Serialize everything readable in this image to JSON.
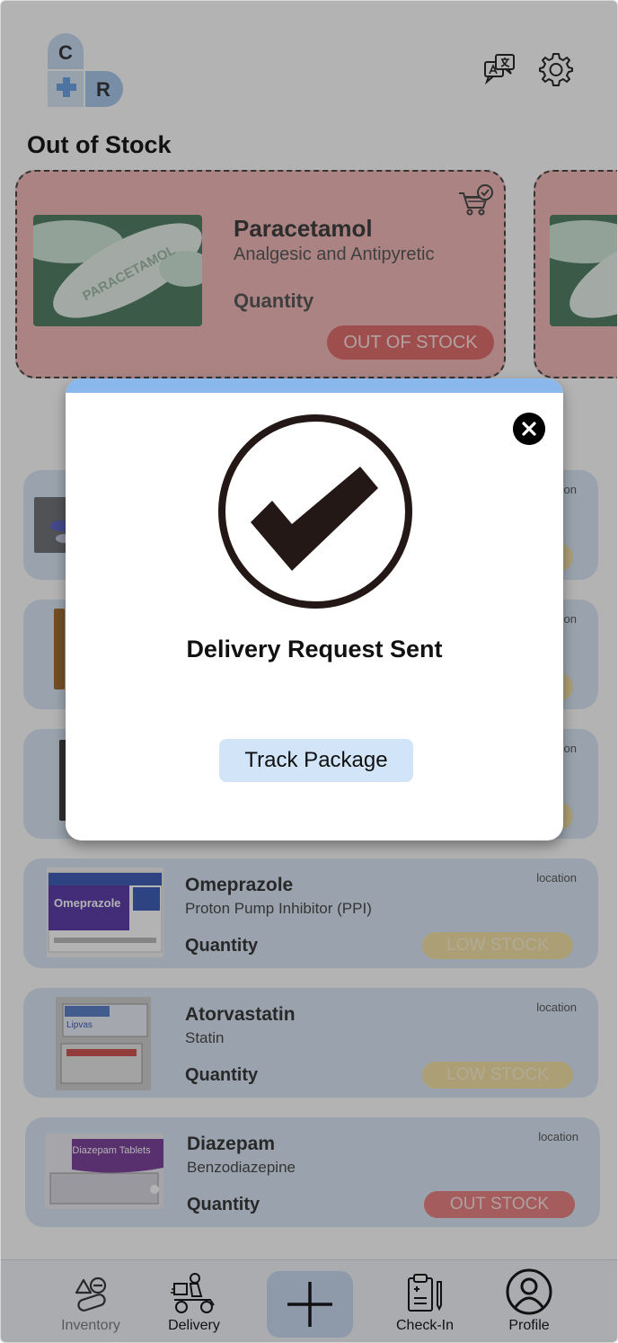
{
  "header": {
    "logo_letters": [
      "C",
      "R"
    ],
    "translate_icon": "translate-icon",
    "settings_icon": "gear-icon",
    "section_title": "Out of Stock"
  },
  "featured": [
    {
      "name": "Paracetamol",
      "category": "Analgesic and Antipyretic",
      "quantity_label": "Quantity",
      "status": "OUT OF STOCK",
      "image_text": "PARACETAMOL"
    }
  ],
  "list": [
    {
      "name": "Omeprazole",
      "category": "Proton Pump Inhibitor (PPI)",
      "quantity_label": "Quantity",
      "location": "location",
      "status": "LOW STOCK",
      "image_text": "Omeprazole"
    },
    {
      "name": "Atorvastatin",
      "category": "Statin",
      "quantity_label": "Quantity",
      "location": "location",
      "status": "LOW STOCK",
      "image_text": "Lipvas"
    },
    {
      "name": "Diazepam",
      "category": "Benzodiazepine",
      "quantity_label": "Quantity",
      "location": "location",
      "status": "OUT STOCK",
      "image_text": "Diazepam Tablets"
    }
  ],
  "hidden_rows": {
    "location": "location"
  },
  "modal": {
    "title": "Delivery Request Sent",
    "button": "Track Package"
  },
  "nav": {
    "inventory": "Inventory",
    "delivery": "Delivery",
    "checkin": "Check-In",
    "profile": "Profile"
  },
  "colors": {
    "accent": "#8bb8ec",
    "out_of_stock": "#e26a6a",
    "low_stock": "#f5e2a4",
    "card_bg": "#dbe8f7"
  }
}
